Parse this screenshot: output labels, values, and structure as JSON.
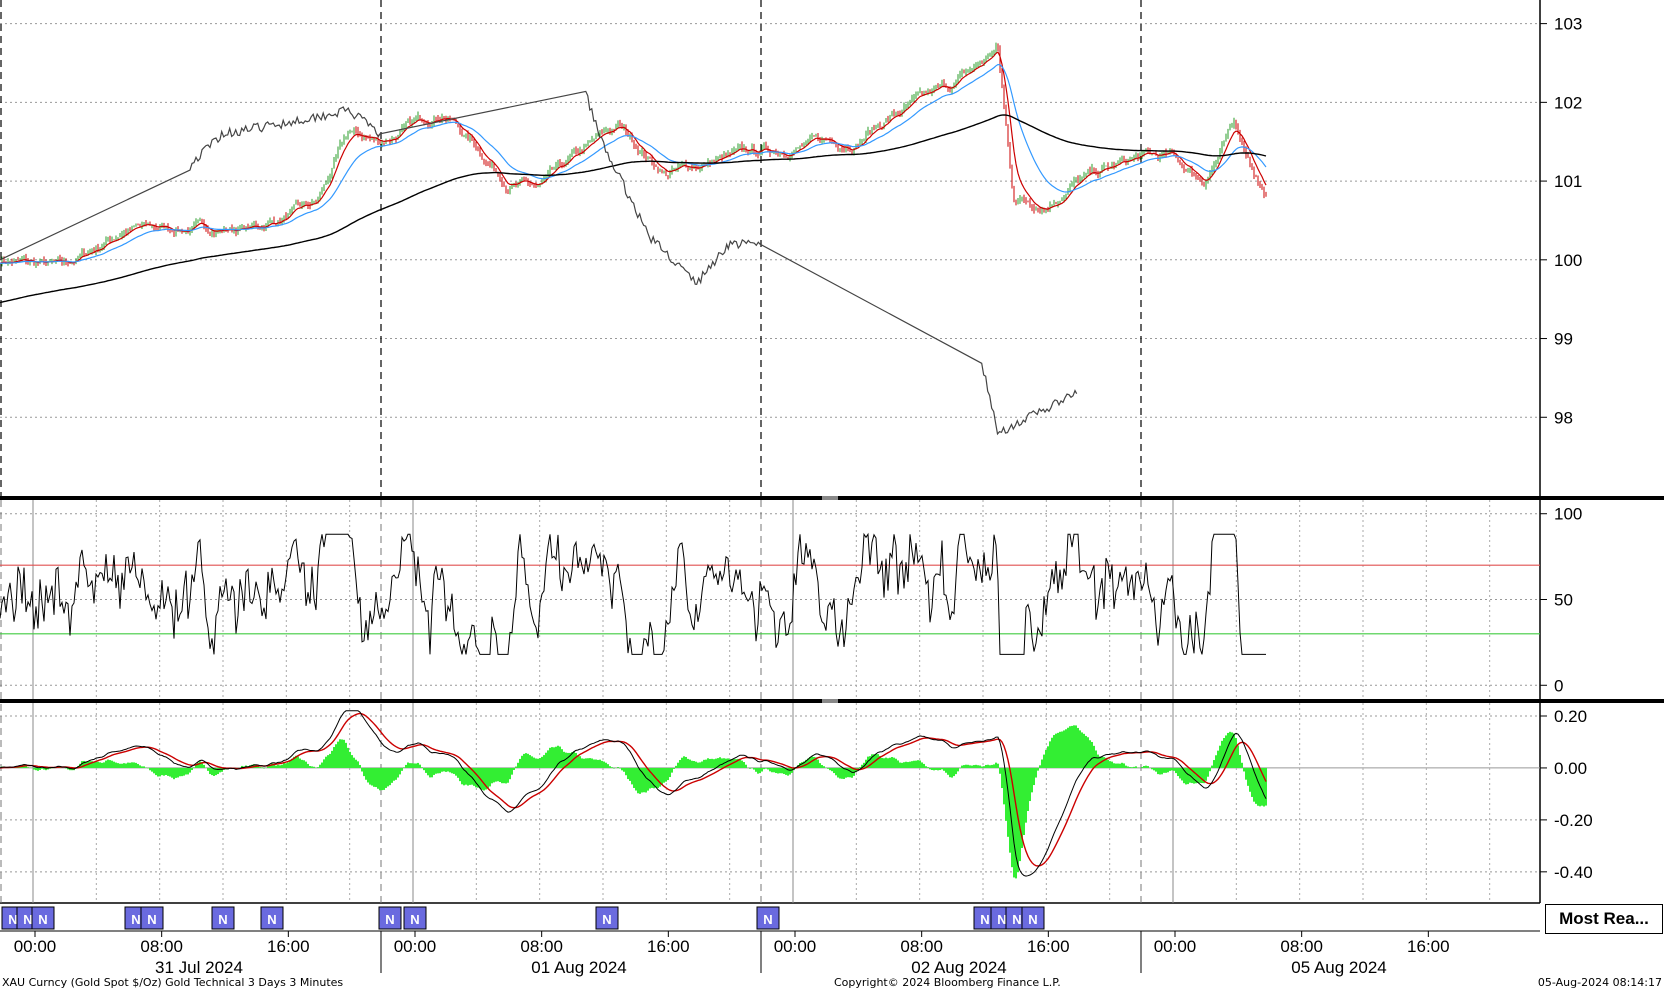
{
  "chart_data": [
    {
      "panel": "price",
      "type": "line",
      "y_ticks": [
        98,
        99,
        100,
        101,
        102,
        103
      ],
      "ylim": [
        97.0,
        103.3
      ],
      "grid": true,
      "series": [],
      "colors": {
        "candles_up": "#2a9d2a",
        "candles_down": "#cc0000",
        "ema_fast": "#cc0000",
        "ema_mid": "#3399ff",
        "ema_slow": "#000000",
        "comparison": "#444444"
      },
      "approx_close_path": {
        "x": [
          "31 Jul 00:00",
          "31 Jul 04:00",
          "31 Jul 08:00",
          "31 Jul 12:00",
          "31 Jul 16:00",
          "31 Jul 20:00",
          "31 Jul 22:00",
          "01 Aug 00:00",
          "01 Aug 04:00",
          "01 Aug 08:00",
          "01 Aug 10:00",
          "01 Aug 13:00",
          "01 Aug 15:00",
          "01 Aug 18:00",
          "01 Aug 22:00",
          "02 Aug 04:00",
          "02 Aug 06:00",
          "02 Aug 08:00",
          "02 Aug 12:00",
          "02 Aug 14:00",
          "02 Aug 15:00",
          "02 Aug 16:00",
          "02 Aug 18:00",
          "02 Aug 20:00",
          "05 Aug 00:00",
          "05 Aug 02:00",
          "05 Aug 04:00",
          "05 Aug 06:00",
          "05 Aug 08:00"
        ],
        "y": [
          100.0,
          99.9,
          100.4,
          100.4,
          100.4,
          100.7,
          101.6,
          101.5,
          101.9,
          101.0,
          100.9,
          101.4,
          101.7,
          101.1,
          101.3,
          101.5,
          101.5,
          101.8,
          102.2,
          102.5,
          102.7,
          100.8,
          100.7,
          101.0,
          101.3,
          101.3,
          101.0,
          101.7,
          100.8
        ]
      },
      "comparison_path": {
        "x": [
          "31 Jul 00:00",
          "31 Jul 12:00",
          "31 Jul 14:00",
          "31 Jul 17:00",
          "31 Jul 22:00",
          "01 Aug 00:00",
          "01 Aug 13:00",
          "01 Aug 14:00",
          "01 Aug 17:00",
          "01 Aug 20:00",
          "01 Aug 22:00",
          "02 Aug 00:00",
          "02 Aug 14:00",
          "02 Aug 15:00",
          "02 Aug 16:00",
          "02 Aug 18:00",
          "02 Aug 20:00"
        ],
        "y": [
          100.0,
          101.2,
          101.6,
          101.7,
          101.9,
          101.6,
          102.1,
          101.5,
          100.3,
          99.7,
          100.2,
          100.2,
          98.7,
          97.8,
          97.9,
          98.1,
          98.3
        ]
      }
    },
    {
      "panel": "rsi",
      "type": "line",
      "y_ticks": [
        0,
        50,
        100
      ],
      "ylim": [
        -8,
        108
      ],
      "reference_lines": [
        {
          "value": 70,
          "color": "#e05050"
        },
        {
          "value": 30,
          "color": "#40cc40"
        }
      ],
      "series": []
    },
    {
      "panel": "macd",
      "type": "line",
      "y_ticks": [
        "0.20",
        "0.00",
        "-0.20",
        "-0.40"
      ],
      "ylim": [
        -0.52,
        0.25
      ],
      "series": []
    }
  ],
  "x_axis": {
    "time_labels": [
      "00:00",
      "08:00",
      "16:00",
      "00:00",
      "08:00",
      "16:00",
      "00:00",
      "08:00",
      "16:00",
      "00:00",
      "08:00",
      "16:00"
    ],
    "date_labels": [
      "31 Jul 2024",
      "01 Aug 2024",
      "02 Aug 2024",
      "05 Aug 2024"
    ]
  },
  "news_markers": {
    "label": "N",
    "count": 16
  },
  "most_read_button": "Most Rea...",
  "footer": {
    "left": "XAU Curncy (Gold Spot  $/Oz) Gold Technical 3 Days 3 Minutes",
    "center": "Copyright© 2024 Bloomberg Finance L.P.",
    "right": "05-Aug-2024 08:14:17"
  }
}
